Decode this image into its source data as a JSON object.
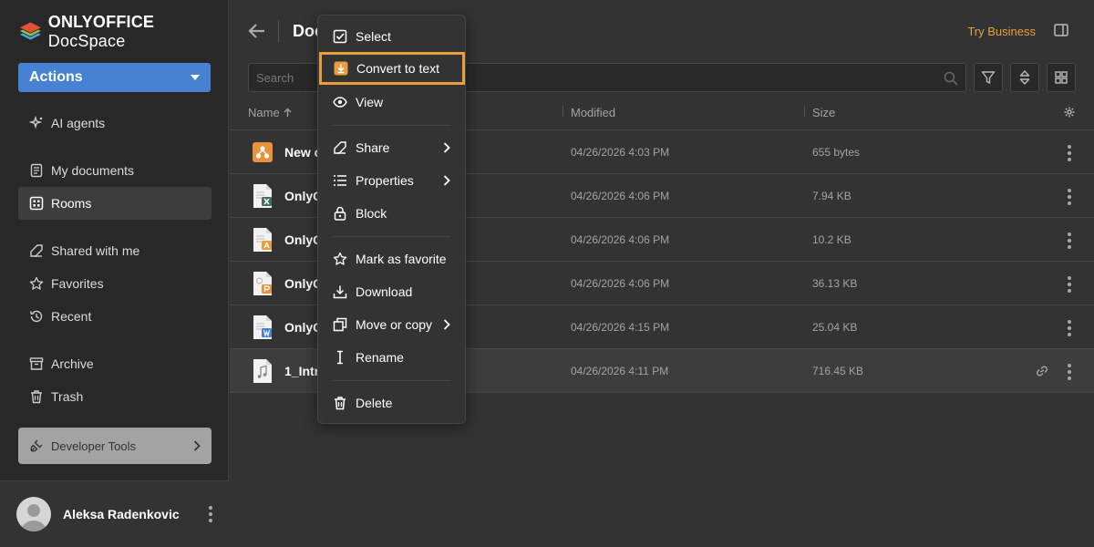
{
  "app": {
    "logo_bold": "ONLYOFFICE",
    "logo_rest": " DocSpace",
    "accent": "#4781d1",
    "highlight": "#e89e3c"
  },
  "sidebar": {
    "actions_label": "Actions",
    "items": [
      {
        "label": "AI agents",
        "icon": "ai-agents-icon"
      },
      {
        "label": "My documents",
        "icon": "document-icon"
      },
      {
        "label": "Rooms",
        "icon": "rooms-icon",
        "active": true
      },
      {
        "label": "Shared with me",
        "icon": "shared-icon"
      },
      {
        "label": "Favorites",
        "icon": "star-icon"
      },
      {
        "label": "Recent",
        "icon": "recent-icon"
      },
      {
        "label": "Archive",
        "icon": "archive-icon"
      },
      {
        "label": "Trash",
        "icon": "trash-icon"
      }
    ],
    "developer_tools": "Developer Tools",
    "user_name": "Aleksa Radenkovic"
  },
  "header": {
    "title": "Doc",
    "try_business": "Try Business"
  },
  "search": {
    "placeholder": "Search"
  },
  "table": {
    "columns": {
      "name": "Name",
      "modified": "Modified",
      "size": "Size"
    },
    "rows": [
      {
        "name": "New c",
        "modified": "04/26/2026 4:03 PM",
        "size": "655 bytes",
        "icon": "form-icon"
      },
      {
        "name": "OnlyC",
        "modified": "04/26/2026 4:06 PM",
        "size": "7.94 KB",
        "icon": "spreadsheet-icon"
      },
      {
        "name": "OnlyC",
        "modified": "04/26/2026 4:06 PM",
        "size": "10.2 KB",
        "icon": "pdf-icon"
      },
      {
        "name": "OnlyC",
        "modified": "04/26/2026 4:06 PM",
        "size": "36.13 KB",
        "icon": "presentation-icon"
      },
      {
        "name": "OnlyC",
        "modified": "04/26/2026 4:15 PM",
        "size": "25.04 KB",
        "icon": "word-document-icon"
      },
      {
        "name": "1_Intr",
        "modified": "04/26/2026 4:11 PM",
        "size": "716.45 KB",
        "icon": "audio-file-icon",
        "selected": true
      }
    ]
  },
  "context_menu": {
    "select": "Select",
    "convert": "Convert to text",
    "view": "View",
    "share": "Share",
    "properties": "Properties",
    "block": "Block",
    "favorite": "Mark as favorite",
    "download": "Download",
    "move_copy": "Move or copy",
    "rename": "Rename",
    "delete": "Delete"
  }
}
